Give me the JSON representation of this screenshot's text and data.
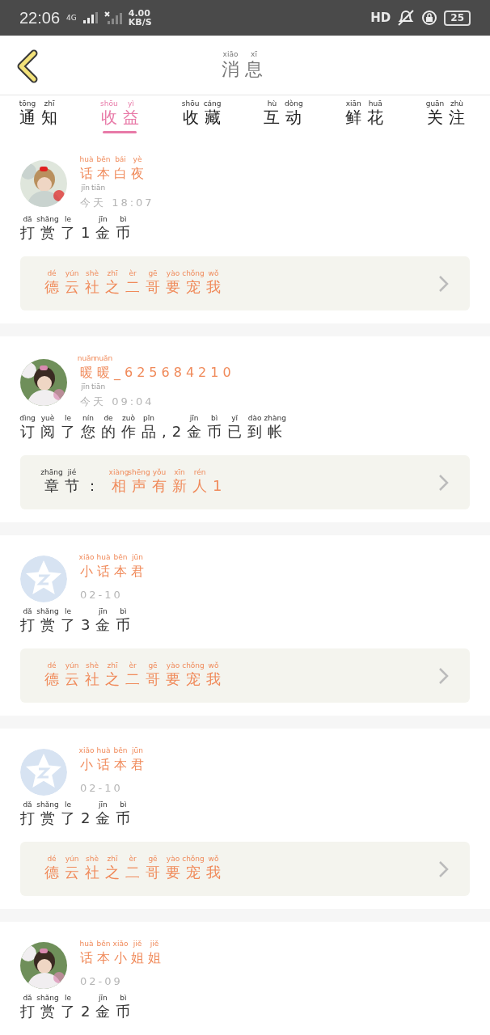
{
  "status_bar": {
    "time": "22:06",
    "network": "4G",
    "speed": "4.00",
    "speed_unit": "KB/S",
    "hd": "HD",
    "battery": "25"
  },
  "header": {
    "title": {
      "text": "消息",
      "pinyin": [
        "xiāo",
        "xī"
      ]
    }
  },
  "tabs": [
    {
      "text": "通知",
      "pinyin": [
        "tōng",
        "zhī"
      ],
      "selected": false
    },
    {
      "text": "收益",
      "pinyin": [
        "shōu",
        "yì"
      ],
      "selected": true
    },
    {
      "text": "收藏",
      "pinyin": [
        "shōu",
        "cáng"
      ],
      "selected": false
    },
    {
      "text": "互动",
      "pinyin": [
        "hù",
        "dòng"
      ],
      "selected": false
    },
    {
      "text": "鲜花",
      "pinyin": [
        "xiān",
        "huā"
      ],
      "selected": false
    },
    {
      "text": "关注",
      "pinyin": [
        "guān",
        "zhù"
      ],
      "selected": false
    }
  ],
  "messages": [
    {
      "name": {
        "text": "话本白夜",
        "pinyin": [
          "huà",
          "běn",
          "bái",
          "yè"
        ]
      },
      "time": {
        "text": "今天 18:07",
        "pinyin": [
          "jīn",
          "tiān"
        ]
      },
      "body": {
        "text": "打赏了1金币",
        "pinyin": [
          "dǎ",
          "shǎng",
          "le",
          "jīn",
          "bì"
        ]
      },
      "link": {
        "value": {
          "text": "德云社之二哥要宠我",
          "pinyin": [
            "dé",
            "yún",
            "shè",
            "zhī",
            "èr",
            "gē",
            "yào",
            "chǒng",
            "wǒ"
          ]
        }
      }
    },
    {
      "name": {
        "text": "暖暖_625684210",
        "pinyin": [
          "nuǎn",
          "nuǎn"
        ]
      },
      "time": {
        "text": "今天 09:04",
        "pinyin": [
          "jīn",
          "tiān"
        ]
      },
      "body": {
        "text": "订阅了您的作品,2金币已到帐",
        "pinyin": [
          "dìng",
          "yuè",
          "le",
          "nín",
          "de",
          "zuò",
          "pǐn",
          "jīn",
          "bì",
          "yǐ",
          "dào",
          "zhàng"
        ]
      },
      "link": {
        "label": {
          "text": "章节：",
          "pinyin": [
            "zhāng",
            "jié"
          ]
        },
        "value": {
          "text": "相声有新人1",
          "pinyin": [
            "xiàng",
            "shēng",
            "yǒu",
            "xīn",
            "rén"
          ]
        }
      }
    },
    {
      "avatar": {
        "kind": "default"
      },
      "name": {
        "text": "小话本君",
        "pinyin": [
          "xiǎo",
          "huà",
          "běn",
          "jūn"
        ]
      },
      "time": {
        "text": "02-10"
      },
      "body": {
        "text": "打赏了3金币",
        "pinyin": [
          "dǎ",
          "shǎng",
          "le",
          "jīn",
          "bì"
        ]
      },
      "link": {
        "value": {
          "text": "德云社之二哥要宠我",
          "pinyin": [
            "dé",
            "yún",
            "shè",
            "zhī",
            "èr",
            "gē",
            "yào",
            "chǒng",
            "wǒ"
          ]
        }
      }
    },
    {
      "avatar": {
        "kind": "default"
      },
      "name": {
        "text": "小话本君",
        "pinyin": [
          "xiǎo",
          "huà",
          "běn",
          "jūn"
        ]
      },
      "time": {
        "text": "02-10"
      },
      "body": {
        "text": "打赏了2金币",
        "pinyin": [
          "dǎ",
          "shǎng",
          "le",
          "jīn",
          "bì"
        ]
      },
      "link": {
        "value": {
          "text": "德云社之二哥要宠我",
          "pinyin": [
            "dé",
            "yún",
            "shè",
            "zhī",
            "èr",
            "gē",
            "yào",
            "chǒng",
            "wǒ"
          ]
        }
      }
    },
    {
      "name": {
        "text": "话本小姐姐",
        "pinyin": [
          "huà",
          "běn",
          "xiǎo",
          "jiě",
          "jiě"
        ]
      },
      "time": {
        "text": "02-09"
      },
      "body": {
        "text": "打赏了2金币",
        "pinyin": [
          "dǎ",
          "shǎng",
          "le",
          "jīn",
          "bì"
        ]
      }
    }
  ]
}
